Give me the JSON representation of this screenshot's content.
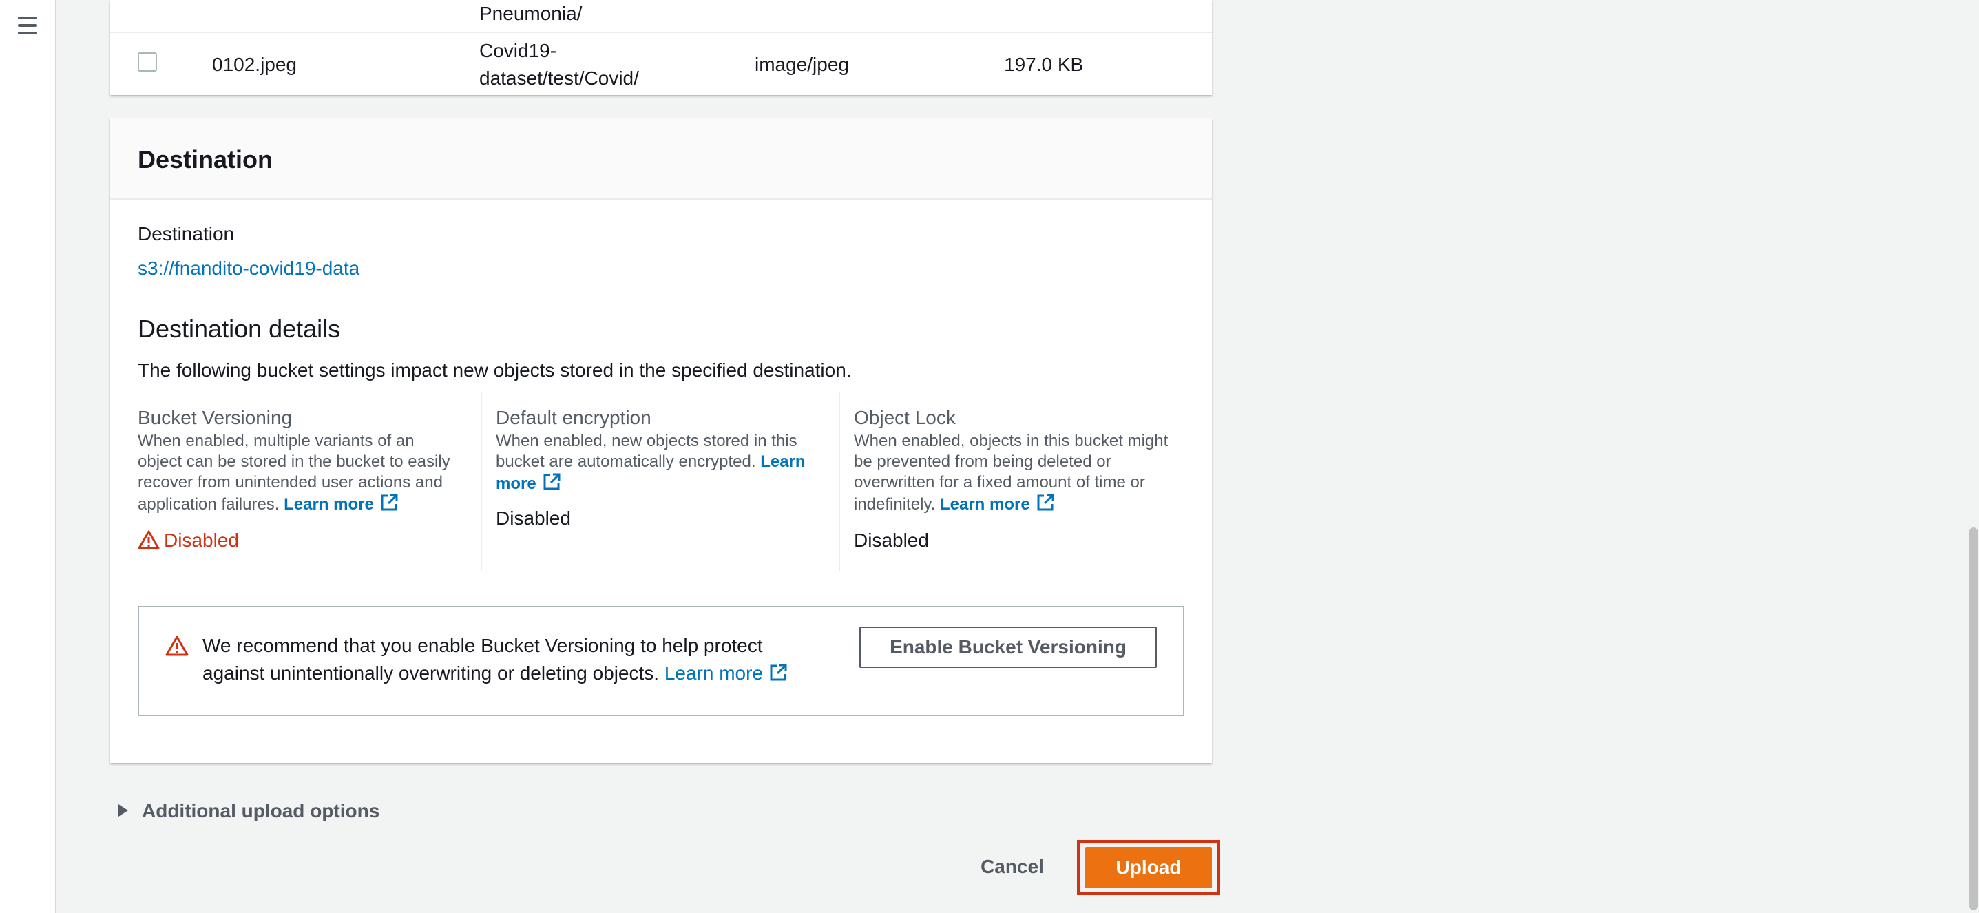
{
  "nav": {
    "menu_icon": "hamburger-menu-icon"
  },
  "files_table": {
    "partial_row": {
      "destination_tail": "Pneumonia/"
    },
    "rows": [
      {
        "name": "0102.jpeg",
        "destination_line1": "Covid19-",
        "destination_line2": "dataset/test/Covid/",
        "type": "image/jpeg",
        "size": "197.0 KB",
        "checked": false
      }
    ]
  },
  "destination": {
    "section_title": "Destination",
    "label": "Destination",
    "bucket_link": "s3://fnandito-covid19-data",
    "details_title": "Destination details",
    "details_desc": "The following bucket settings impact new objects stored in the specified destination.",
    "columns": [
      {
        "title": "Bucket Versioning",
        "desc_lines": [
          "When enabled, multiple variants of an",
          "object can be stored in the bucket to easily",
          "recover from unintended user actions and",
          "application failures."
        ],
        "learn_more": "Learn more",
        "value": "Disabled",
        "status_color": "#d13212",
        "status_icon": "warning-triangle-icon"
      },
      {
        "title": "Default encryption",
        "desc_lines": [
          "When enabled, new objects stored in this",
          "bucket are automatically encrypted."
        ],
        "learn_more_a": "Learn",
        "learn_more_b": "more",
        "value": "Disabled"
      },
      {
        "title": "Object Lock",
        "desc_lines": [
          "When enabled, objects in this bucket might",
          "be prevented from being deleted or",
          "overwritten for a fixed amount of time or",
          "indefinitely."
        ],
        "learn_more": "Learn more",
        "value": "Disabled"
      }
    ],
    "warning": {
      "line1": "We recommend that you enable Bucket Versioning to help protect",
      "line2": "against unintentionally overwriting or deleting objects.",
      "learn_more": "Learn more",
      "button": "Enable Bucket Versioning"
    }
  },
  "additional_options": "Additional upload options",
  "actions": {
    "cancel": "Cancel",
    "upload": "Upload"
  },
  "colors": {
    "accent": "#ec7211",
    "link": "#0073bb",
    "error": "#d13212",
    "highlight": "#d13212"
  }
}
